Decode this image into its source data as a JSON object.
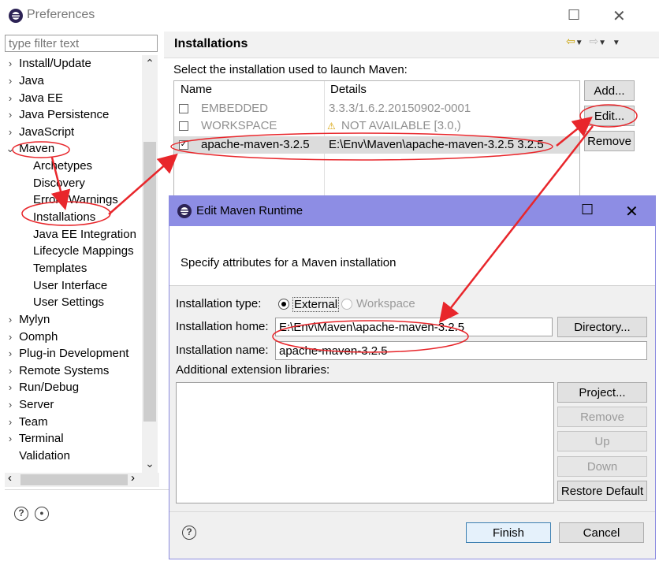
{
  "preferences": {
    "title": "Preferences",
    "filter_placeholder": "type filter text",
    "tree": [
      {
        "label": "Install/Update",
        "expanded": false
      },
      {
        "label": "Java",
        "expanded": false
      },
      {
        "label": "Java EE",
        "expanded": false
      },
      {
        "label": "Java Persistence",
        "expanded": false
      },
      {
        "label": "JavaScript",
        "expanded": false
      },
      {
        "label": "Maven",
        "expanded": true
      }
    ],
    "maven_children": [
      "Archetypes",
      "Discovery",
      "Errors/Warnings",
      "Installations",
      "Java EE Integration",
      "Lifecycle Mappings",
      "Templates",
      "User Interface",
      "User Settings"
    ],
    "tree_after": [
      {
        "label": "Mylyn",
        "arrow": true
      },
      {
        "label": "Oomph",
        "arrow": true
      },
      {
        "label": "Plug-in Development",
        "arrow": true
      },
      {
        "label": "Remote Systems",
        "arrow": true
      },
      {
        "label": "Run/Debug",
        "arrow": true
      },
      {
        "label": "Server",
        "arrow": true
      },
      {
        "label": "Team",
        "arrow": true
      },
      {
        "label": "Terminal",
        "arrow": true
      },
      {
        "label": "Validation",
        "arrow": false
      }
    ],
    "selected_item": "Installations"
  },
  "installations_page": {
    "title": "Installations",
    "instruction": "Select the installation used to launch Maven:",
    "columns": [
      "Name",
      "Details"
    ],
    "rows": [
      {
        "name": "EMBEDDED",
        "details": "3.3.3/1.6.2.20150902-0001",
        "checked": false,
        "grayed": true,
        "warning": false
      },
      {
        "name": "WORKSPACE",
        "details": "NOT AVAILABLE [3.0,)",
        "checked": false,
        "grayed": true,
        "warning": true
      },
      {
        "name": "apache-maven-3.2.5",
        "details": "E:\\Env\\Maven\\apache-maven-3.2.5 3.2.5",
        "checked": true,
        "grayed": false,
        "warning": false
      }
    ],
    "buttons": {
      "add": "Add...",
      "edit": "Edit...",
      "remove": "Remove"
    }
  },
  "dialog": {
    "title": "Edit Maven Runtime",
    "message": "Specify attributes for a Maven installation",
    "installation_type_label": "Installation type:",
    "type_external": "External",
    "type_workspace": "Workspace",
    "selected_type": "External",
    "home_label": "Installation home:",
    "home_value": "E:\\Env\\Maven\\apache-maven-3.2.5",
    "directory_button": "Directory...",
    "name_label": "Installation name:",
    "name_value": "apache-maven-3.2.5",
    "ext_label": "Additional extension libraries:",
    "buttons": {
      "project": "Project...",
      "remove": "Remove",
      "up": "Up",
      "down": "Down",
      "restore_default": "Restore Default",
      "finish": "Finish",
      "cancel": "Cancel"
    }
  },
  "colors": {
    "dialog_titlebar": "#8d8de4",
    "annotation": "#e8262b"
  }
}
